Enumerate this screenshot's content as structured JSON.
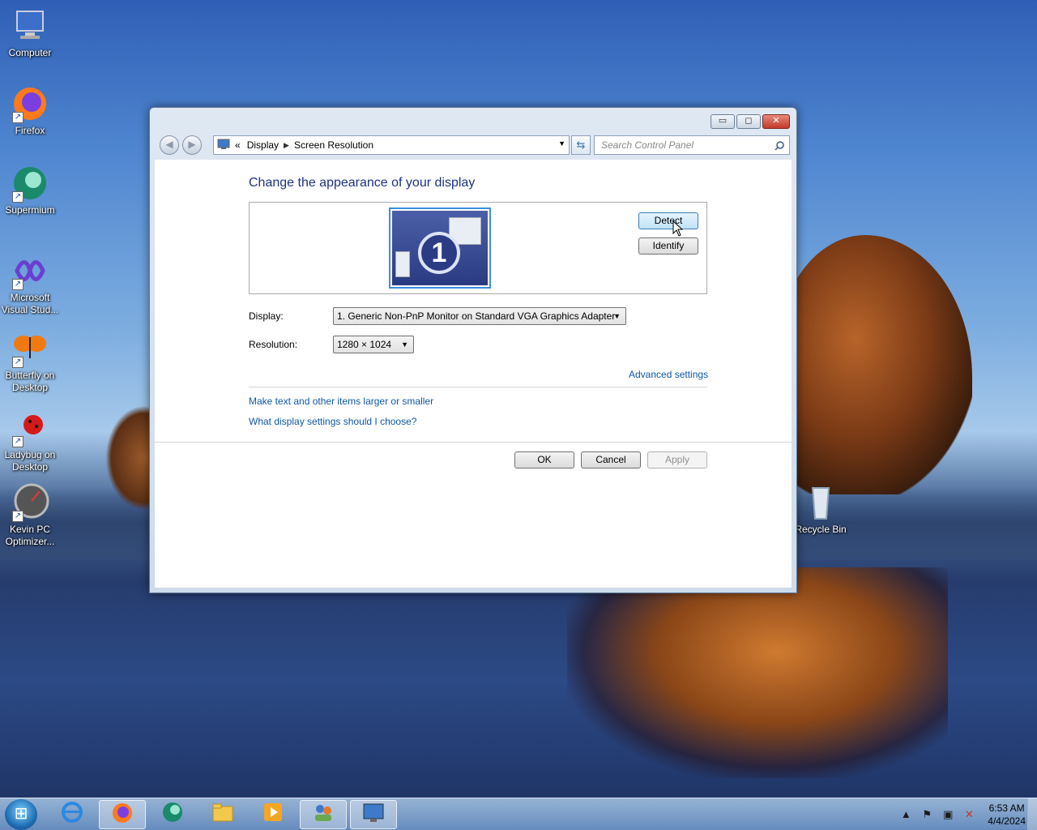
{
  "desktop": {
    "icons": [
      {
        "label": "Computer"
      },
      {
        "label": "Firefox"
      },
      {
        "label": "Supermium"
      },
      {
        "label": "Microsoft Visual Stud..."
      },
      {
        "label": "Butterfly on Desktop"
      },
      {
        "label": "Ladybug on Desktop"
      },
      {
        "label": "Kevin PC Optimizer..."
      },
      {
        "label": "Recycle Bin"
      }
    ]
  },
  "window": {
    "controls": {
      "minimize": "▭",
      "maximize": "◻",
      "close": "✕"
    },
    "address": {
      "icon": "control-panel-icon",
      "prefix": "«",
      "crumbs": [
        "Display",
        "Screen Resolution"
      ]
    },
    "search_placeholder": "Search Control Panel",
    "heading": "Change the appearance of your display",
    "monitor_number": "1",
    "detect_label": "Detect",
    "identify_label": "Identify",
    "display_label": "Display:",
    "display_value": "1. Generic Non-PnP Monitor on Standard VGA Graphics Adapter",
    "resolution_label": "Resolution:",
    "resolution_value": "1280 × 1024",
    "advanced_link": "Advanced settings",
    "link_larger": "Make text and other items larger or smaller",
    "link_help": "What display settings should I choose?",
    "ok_label": "OK",
    "cancel_label": "Cancel",
    "apply_label": "Apply"
  },
  "taskbar": {
    "clock_time": "6:53 AM",
    "clock_date": "4/4/2024"
  },
  "colors": {
    "heading": "#1e3287",
    "link": "#0f57a7",
    "selection_border": "#3b8fe0"
  }
}
